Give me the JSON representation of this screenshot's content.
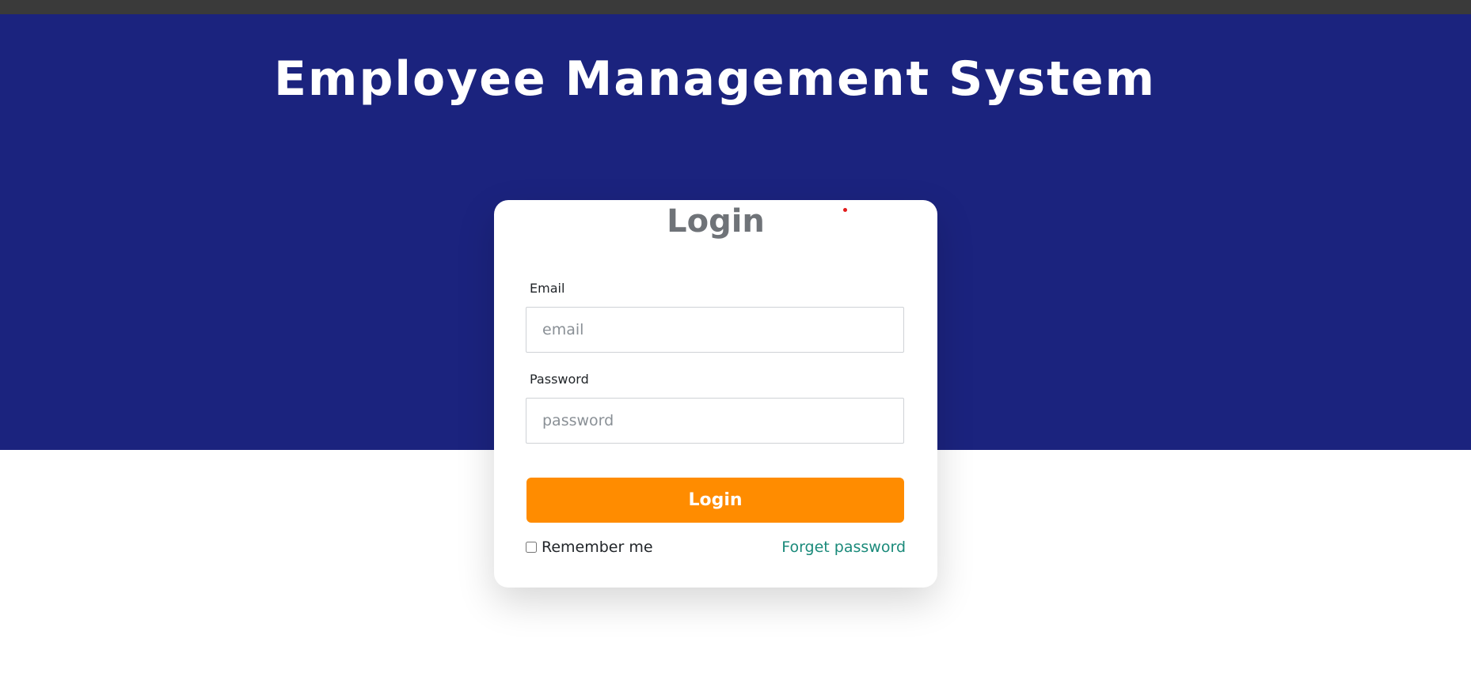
{
  "header": {
    "title": "Employee Management System"
  },
  "login_card": {
    "title": "Login",
    "email_label": "Email",
    "email_placeholder": "email",
    "email_value": "",
    "password_label": "Password",
    "password_placeholder": "password",
    "password_value": "",
    "submit_label": "Login",
    "remember_label": "Remember me",
    "remember_checked": false,
    "forget_label": "Forget password"
  },
  "colors": {
    "hero_background": "#1b237e",
    "primary_button": "#ff8c00",
    "link": "#1a8a7a",
    "card_title": "#6f7378"
  }
}
